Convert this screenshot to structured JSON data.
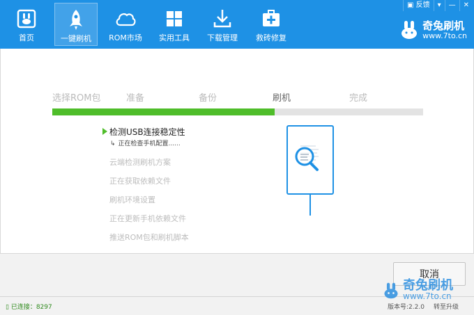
{
  "nav": {
    "items": [
      {
        "label": "首页"
      },
      {
        "label": "一键刷机"
      },
      {
        "label": "ROM市场"
      },
      {
        "label": "实用工具"
      },
      {
        "label": "下载管理"
      },
      {
        "label": "救砖修复"
      }
    ],
    "active_index": 1
  },
  "window_controls": {
    "feedback": "反馈",
    "menu_icon": "dropdown-arrow-icon",
    "minimize": "—",
    "close": "✕"
  },
  "brand": {
    "name": "奇兔刷机",
    "url": "www.7to.cn"
  },
  "steps": {
    "items": [
      {
        "label": "选择ROM包"
      },
      {
        "label": "准备"
      },
      {
        "label": "备份"
      },
      {
        "label": "刷机"
      },
      {
        "label": "完成"
      }
    ],
    "current_index": 3
  },
  "progress": {
    "value_fraction": 0.6,
    "fill_color": "#4fbd2a",
    "track_color": "#e3e3e3"
  },
  "tasks": {
    "items": [
      {
        "label": "检测USB连接稳定性",
        "state": "active"
      },
      {
        "label": "云端检测刷机方案",
        "state": "pending"
      },
      {
        "label": "正在获取依赖文件",
        "state": "pending"
      },
      {
        "label": "刷机环境设置",
        "state": "pending"
      },
      {
        "label": "正在更新手机依赖文件",
        "state": "pending"
      },
      {
        "label": "推送ROM包和刷机脚本",
        "state": "pending"
      }
    ],
    "sub_status": "正在检查手机配置......"
  },
  "illustration": {
    "icon": "phone-magnifier-icon",
    "color": "#1e91e5"
  },
  "buttons": {
    "cancel": "取消"
  },
  "status": {
    "connected": "已连接：8297",
    "version": "版本号:2.2.0",
    "right_text": "转至升级"
  },
  "watermark": {
    "name": "奇兔刷机",
    "url": "www.7to.cn"
  },
  "colors": {
    "primary": "#1e91e5",
    "accent_green": "#4fbd2a"
  }
}
